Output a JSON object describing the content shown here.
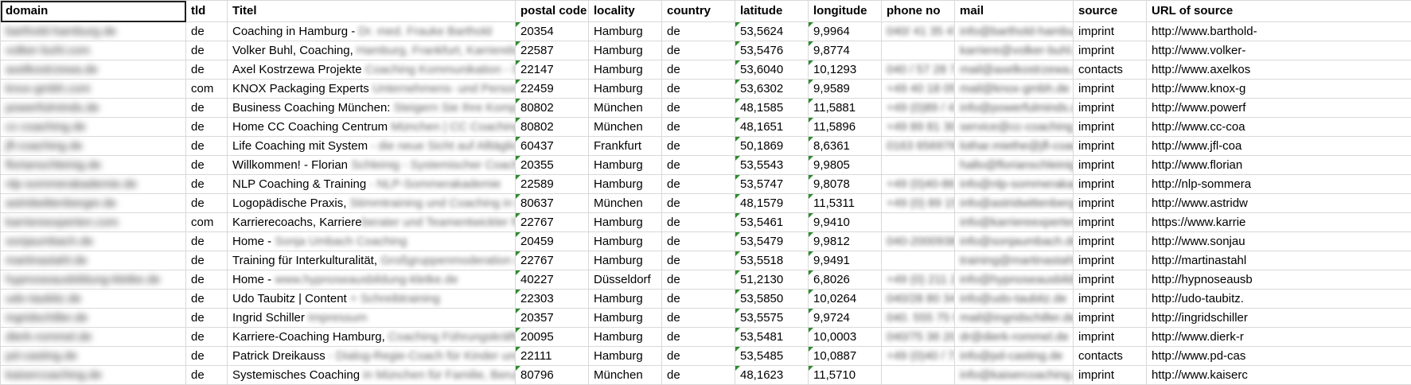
{
  "headers": [
    "domain",
    "tld",
    "Titel",
    "postal code",
    "locality",
    "country",
    "latitude",
    "longitude",
    "phone no",
    "mail",
    "source",
    "URL of source"
  ],
  "rows": [
    {
      "domain": "barthold-hamburg.de",
      "tld": "de",
      "titel_clear": "Coaching in Hamburg -",
      "titel_blur": " Dr. med. Frauke Barthold",
      "postal": "20354",
      "locality": "Hamburg",
      "country": "de",
      "lat": "53,5624",
      "lon": "9,9964",
      "phone": "040/ 41 35 47 00",
      "mail": "info@barthold-hamburg.de",
      "source": "imprint",
      "url": "http://www.barthold-"
    },
    {
      "domain": "volker-buhl.com",
      "tld": "de",
      "titel_clear": "Volker Buhl, Coaching,",
      "titel_blur": " Hamburg, Frankfurt, Karriereberatung",
      "postal": "22587",
      "locality": "Hamburg",
      "country": "de",
      "lat": "53,5476",
      "lon": "9,8774",
      "phone": "",
      "mail": "karriere@volker-buhl.com",
      "source": "imprint",
      "url": "http://www.volker-"
    },
    {
      "domain": "axelkostrzewa.de",
      "tld": "de",
      "titel_clear": "Axel Kostrzewa Projekte",
      "titel_blur": " Coaching Kommunikation - Stadt",
      "postal": "22147",
      "locality": "Hamburg",
      "country": "de",
      "lat": "53,6040",
      "lon": "10,1293",
      "phone": "040 / 57 28 74",
      "mail": "mail@axelkostrzewa.de",
      "source": "contacts",
      "url": "http://www.axelkos"
    },
    {
      "domain": "knox-gmbh.com",
      "tld": "com",
      "titel_clear": "KNOX Packaging Experts",
      "titel_blur": " Unternehmens- und Personalberatung",
      "postal": "22459",
      "locality": "Hamburg",
      "country": "de",
      "lat": "53,6302",
      "lon": "9,9589",
      "phone": "+49 40 18 05 00",
      "mail": "mail@knox-gmbh.de",
      "source": "imprint",
      "url": "http://www.knox-g"
    },
    {
      "domain": "powerfulminds.de",
      "tld": "de",
      "titel_clear": "Business Coaching München:",
      "titel_blur": " Steigern Sie Ihre Kompetenz",
      "postal": "80802",
      "locality": "München",
      "country": "de",
      "lat": "48,1585",
      "lon": "11,5881",
      "phone": "+49 (0)89 / 41 00",
      "mail": "info@powerfulminds.de",
      "source": "imprint",
      "url": "http://www.powerf"
    },
    {
      "domain": "cc-coaching.de",
      "tld": "de",
      "titel_clear": "Home CC Coaching Centrum",
      "titel_blur": " München | CC Coaching Centrum",
      "postal": "80802",
      "locality": "München",
      "country": "de",
      "lat": "48,1651",
      "lon": "11,5896",
      "phone": "+49 89 81 30 00",
      "mail": "service@cc-coaching.de",
      "source": "imprint",
      "url": "http://www.cc-coa"
    },
    {
      "domain": "jfl-coaching.de",
      "tld": "de",
      "titel_clear": "Life Coaching mit System",
      "titel_blur": " - die neue Sicht auf Alltägliches",
      "postal": "60437",
      "locality": "Frankfurt",
      "country": "de",
      "lat": "50,1869",
      "lon": "8,6361",
      "phone": "0163 6569760",
      "mail": "lothar.miethe@jfl-coaching.de",
      "source": "imprint",
      "url": "http://www.jfl-coa"
    },
    {
      "domain": "florianschleinig.de",
      "tld": "de",
      "titel_clear": "Willkommen! - Florian",
      "titel_blur": " Schleinig - Systemischer Coach Hamburg",
      "postal": "20355",
      "locality": "Hamburg",
      "country": "de",
      "lat": "53,5543",
      "lon": "9,9805",
      "phone": "",
      "mail": "hallo@florianschleinig.de",
      "source": "imprint",
      "url": "http://www.florian"
    },
    {
      "domain": "nlp-sommerakademie.de",
      "tld": "de",
      "titel_clear": "NLP Coaching & Training",
      "titel_blur": " - NLP-Sommerakademie",
      "postal": "22589",
      "locality": "Hamburg",
      "country": "de",
      "lat": "53,5747",
      "lon": "9,8078",
      "phone": "+49 (0)40-86 00",
      "mail": "info@nlp-sommerakademie.de",
      "source": "imprint",
      "url": "http://nlp-sommera"
    },
    {
      "domain": "astridwittenberger.de",
      "tld": "de",
      "titel_clear": "Logopädische Praxis,",
      "titel_blur": " Stimmtraining und Coaching in München",
      "postal": "80637",
      "locality": "München",
      "country": "de",
      "lat": "48,1579",
      "lon": "11,5311",
      "phone": "+49 (0) 89 15 00",
      "mail": "info@astridwittenberger.de",
      "source": "imprint",
      "url": "http://www.astridw"
    },
    {
      "domain": "karriereexperten.com",
      "tld": "com",
      "titel_clear": "Karrierecoachs, Karriere",
      "titel_blur": "berater und Teamentwickler für",
      "postal": "22767",
      "locality": "Hamburg",
      "country": "de",
      "lat": "53,5461",
      "lon": "9,9410",
      "phone": "",
      "mail": "info@karriereexperten.com",
      "source": "imprint",
      "url": "https://www.karrie"
    },
    {
      "domain": "sonjaumbach.de",
      "tld": "de",
      "titel_clear": "Home -",
      "titel_blur": " Sonja Umbach Coaching",
      "postal": "20459",
      "locality": "Hamburg",
      "country": "de",
      "lat": "53,5479",
      "lon": "9,9812",
      "phone": "040-2000938",
      "mail": "info@sonjaumbach.de",
      "source": "imprint",
      "url": "http://www.sonjau"
    },
    {
      "domain": "martinastahl.de",
      "tld": "de",
      "titel_clear": "Training für Interkulturalität,",
      "titel_blur": " Großgruppenmoderation und",
      "postal": "22767",
      "locality": "Hamburg",
      "country": "de",
      "lat": "53,5518",
      "lon": "9,9491",
      "phone": "",
      "mail": "training@martinastahl.de",
      "source": "imprint",
      "url": "http://martinastahl"
    },
    {
      "domain": "hypnoseausbildung-kletke.de",
      "tld": "de",
      "titel_clear": "Home -",
      "titel_blur": " www.hypnoseausbildung-kletke.de",
      "postal": "40227",
      "locality": "Düsseldorf",
      "country": "de",
      "lat": "51,2130",
      "lon": "6,8026",
      "phone": "+49 (0) 211 27 00",
      "mail": "info@hypnoseausbildung.de",
      "source": "imprint",
      "url": "http://hypnoseausb"
    },
    {
      "domain": "udo-taubitz.de",
      "tld": "de",
      "titel_clear": "Udo Taubitz | Content",
      "titel_blur": " + Schreibtraining",
      "postal": "22303",
      "locality": "Hamburg",
      "country": "de",
      "lat": "53,5850",
      "lon": "10,0264",
      "phone": "040/28 80 34",
      "mail": "info@udo-taubitz.de",
      "source": "imprint",
      "url": "http://udo-taubitz."
    },
    {
      "domain": "ingridschiller.de",
      "tld": "de",
      "titel_clear": "Ingrid Schiller",
      "titel_blur": " Impressum",
      "postal": "20357",
      "locality": "Hamburg",
      "country": "de",
      "lat": "53,5575",
      "lon": "9,9724",
      "phone": "040. 555 75 90",
      "mail": "mail@ingridschiller.de",
      "source": "imprint",
      "url": "http://ingridschiller"
    },
    {
      "domain": "dierk-rommel.de",
      "tld": "de",
      "titel_clear": "Karriere-Coaching Hamburg,",
      "titel_blur": " Coaching Führungskräfte K",
      "postal": "20095",
      "locality": "Hamburg",
      "country": "de",
      "lat": "53,5481",
      "lon": "10,0003",
      "phone": "040/75 36 20",
      "mail": "dr@dierk-rommel.de",
      "source": "imprint",
      "url": "http://www.dierk-r"
    },
    {
      "domain": "pd-casting.de",
      "tld": "de",
      "titel_clear": "Patrick Dreikauss",
      "titel_blur": " - Dialog-Regie-Coach für Kinder und Ju",
      "postal": "22111",
      "locality": "Hamburg",
      "country": "de",
      "lat": "53,5485",
      "lon": "10,0887",
      "phone": "+49 (0)40 / 71 00",
      "mail": "info@pd-casting.de",
      "source": "contacts",
      "url": "http://www.pd-cas"
    },
    {
      "domain": "kaisercoaching.de",
      "tld": "de",
      "titel_clear": "Systemisches Coaching",
      "titel_blur": " in München für Familie, Beruf und",
      "postal": "80796",
      "locality": "München",
      "country": "de",
      "lat": "48,1623",
      "lon": "11,5710",
      "phone": "",
      "mail": "info@kaisercoaching.de",
      "source": "imprint",
      "url": "http://www.kaiserc"
    }
  ]
}
